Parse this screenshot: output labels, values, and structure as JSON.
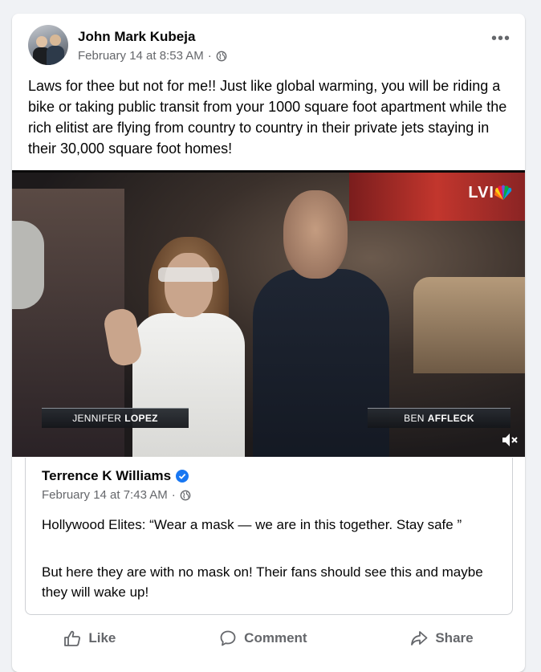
{
  "post": {
    "author": "John Mark Kubeja",
    "timestamp": "February 14 at 8:53 AM",
    "separator": "·",
    "audience_icon": "globe-icon",
    "more_icon": "•••",
    "text": "Laws for thee but not for me!! Just like global warming, you will be riding a bike or taking public transit from your 1000 square foot apartment while the rich elitist are flying from country to country in their private jets staying in their 30,000 square foot homes!"
  },
  "video": {
    "lower_third_left_first": "JENNIFER",
    "lower_third_left_last": "LOPEZ",
    "lower_third_right_first": "BEN",
    "lower_third_right_last": "AFFLECK",
    "broadcast_logo": "LVI",
    "muted": true
  },
  "shared_post": {
    "author": "Terrence K Williams",
    "verified": true,
    "timestamp": "February 14 at 7:43 AM",
    "separator": "·",
    "text1": "Hollywood Elites: “Wear a mask — we are in this together. Stay safe ”",
    "text2": "But here they are with no mask on! Their fans should see this and maybe they will wake up!"
  },
  "actions": {
    "like": "Like",
    "comment": "Comment",
    "share": "Share"
  },
  "colors": {
    "background": "#f0f2f5",
    "card": "#ffffff",
    "secondary_text": "#65676b",
    "verified_blue": "#1877f2"
  }
}
